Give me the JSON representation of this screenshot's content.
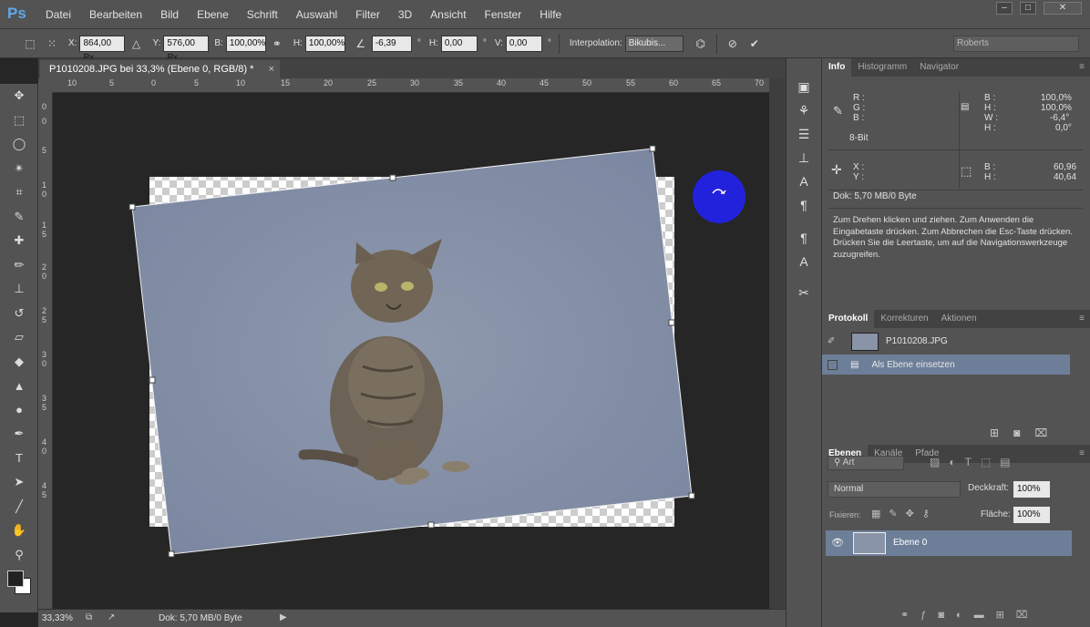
{
  "app": {
    "logo": "Ps"
  },
  "menu": [
    "Datei",
    "Bearbeiten",
    "Bild",
    "Ebene",
    "Schrift",
    "Auswahl",
    "Filter",
    "3D",
    "Ansicht",
    "Fenster",
    "Hilfe"
  ],
  "window_controls": [
    "‒",
    "□",
    "✕"
  ],
  "options": {
    "x_label": "X:",
    "x_value": "864,00 Px",
    "y_label": "Y:",
    "y_value": "576,00 Px",
    "w_label": "B:",
    "w_value": "100,00%",
    "h_label": "H:",
    "h_value": "100,00%",
    "angle_value": "-6,39",
    "angle_unit": "°",
    "hskew_label": "H:",
    "hskew_value": "0,00",
    "hskew_unit": "°",
    "vskew_label": "V:",
    "vskew_value": "0,00",
    "vskew_unit": "°",
    "interp_label": "Interpolation:",
    "interp_value": "Bikubis...",
    "workspace": "Roberts"
  },
  "document": {
    "tab_title": "P1010208.JPG bei 33,3% (Ebene 0, RGB/8) *",
    "close": "×"
  },
  "ruler_h": [
    "10",
    "5",
    "0",
    "5",
    "10",
    "15",
    "20",
    "25",
    "30",
    "35",
    "40",
    "45",
    "50",
    "55",
    "60",
    "65",
    "70"
  ],
  "ruler_v": [
    "0",
    "0",
    "5",
    "1",
    "0",
    "1",
    "5",
    "2",
    "0",
    "2",
    "5",
    "3",
    "0",
    "3",
    "5",
    "4",
    "0",
    "4",
    "5"
  ],
  "status": {
    "zoom": "33,33%",
    "doc": "Dok: 5,70 MB/0 Byte"
  },
  "info_panel": {
    "tabs": [
      "Info",
      "Histogramm",
      "Navigator"
    ],
    "r": "R :",
    "g": "G :",
    "b": "B :",
    "bit": "8-Bit",
    "w_lbl": "B :",
    "w_val": "100,0%",
    "h_lbl": "H :",
    "h_val": "100,0%",
    "w2_lbl": "W :",
    "w2_val": "-6,4°",
    "h2_lbl": "H :",
    "h2_val": "0,0°",
    "x_lbl": "X :",
    "y_lbl": "Y :",
    "bw_lbl": "B :",
    "bw_val": "60,96",
    "bh_lbl": "H :",
    "bh_val": "40,64",
    "doc": "Dok: 5,70 MB/0 Byte",
    "hint": "Zum Drehen klicken und ziehen. Zum Anwenden die Eingabetaste drücken. Zum Abbrechen die Esc-Taste drücken. Drücken Sie die Leertaste, um auf die Navigationswerkzeuge zuzugreifen."
  },
  "history_panel": {
    "tabs": [
      "Protokoll",
      "Korrekturen",
      "Aktionen"
    ],
    "items": [
      {
        "label": "P1010208.JPG"
      },
      {
        "label": "Als Ebene einsetzen"
      }
    ]
  },
  "layers_panel": {
    "tabs": [
      "Ebenen",
      "Kanäle",
      "Pfade"
    ],
    "filter": "Art",
    "blend": "Normal",
    "opacity_label": "Deckkraft:",
    "opacity": "100%",
    "lock_label": "Fixieren:",
    "fill_label": "Fläche:",
    "fill": "100%",
    "layers": [
      {
        "name": "Ebene 0"
      }
    ]
  },
  "colors": {
    "accent": "#5fa8e8",
    "selection": "#6d7f98",
    "cursor_dot": "#2222dd",
    "panel": "#535353"
  }
}
